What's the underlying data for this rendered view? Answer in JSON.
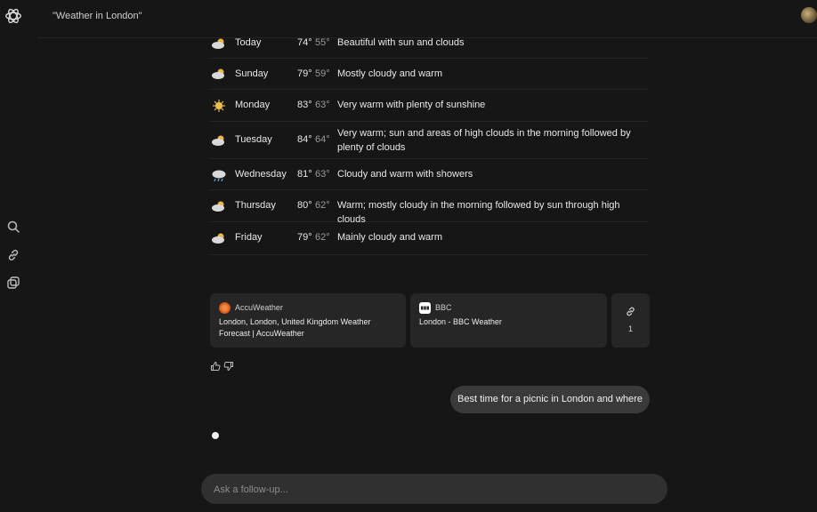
{
  "header": {
    "title": "\"Weather in London\""
  },
  "sidebar": {
    "icons": [
      "search-icon",
      "link-icon",
      "collections-icon"
    ]
  },
  "forecast": [
    {
      "day": "Today",
      "high": "74°",
      "low": "55°",
      "desc": "Beautiful with sun and clouds",
      "icon": "partly-cloudy-icon"
    },
    {
      "day": "Sunday",
      "high": "79°",
      "low": "59°",
      "desc": "Mostly cloudy and warm",
      "icon": "partly-cloudy-icon"
    },
    {
      "day": "Monday",
      "high": "83°",
      "low": "63°",
      "desc": "Very warm with plenty of sunshine",
      "icon": "sun-icon"
    },
    {
      "day": "Tuesday",
      "high": "84°",
      "low": "64°",
      "desc": "Very warm; sun and areas of high clouds in the morning followed by plenty of clouds",
      "icon": "partly-cloudy-icon"
    },
    {
      "day": "Wednesday",
      "high": "81°",
      "low": "63°",
      "desc": "Cloudy and warm with showers",
      "icon": "cloud-rain-icon"
    },
    {
      "day": "Thursday",
      "high": "80°",
      "low": "62°",
      "desc": "Warm; mostly cloudy in the morning followed by sun through high clouds",
      "icon": "partly-cloudy-icon"
    },
    {
      "day": "Friday",
      "high": "79°",
      "low": "62°",
      "desc": "Mainly cloudy and warm",
      "icon": "partly-cloudy-icon"
    }
  ],
  "sources": [
    {
      "name": "AccuWeather",
      "title": "London, London, United Kingdom Weather Forecast | AccuWeather",
      "color": "#e0601e"
    },
    {
      "name": "BBC",
      "title": "London - BBC Weather",
      "color": "#ffffff"
    }
  ],
  "more_sources": {
    "count": "1"
  },
  "user_message": "Best time for a picnic in London and where",
  "composer": {
    "placeholder": "Ask a follow-up..."
  }
}
